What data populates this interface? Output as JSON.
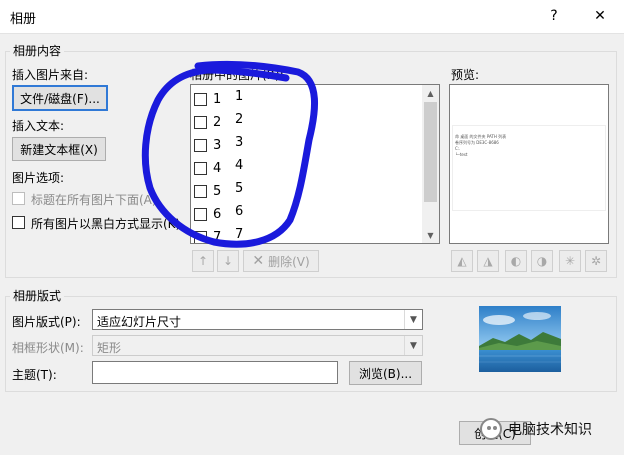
{
  "window": {
    "title": "相册",
    "help_glyph": "?",
    "close_glyph": "✕"
  },
  "album_content": {
    "legend": "相册内容",
    "insert_from_label": "插入图片来自:",
    "file_button": "文件/磁盘(F)...",
    "insert_text_label": "插入文本:",
    "new_textbox_button": "新建文本框(X)",
    "picture_options_label": "图片选项:",
    "caption_option": "标题在所有图片下面(A)",
    "bw_option": "所有图片以黑白方式显示(K)"
  },
  "picture_list": {
    "label": "相册中的图片(R):",
    "items": [
      {
        "index": "1",
        "name": "1"
      },
      {
        "index": "2",
        "name": "2"
      },
      {
        "index": "3",
        "name": "3"
      },
      {
        "index": "4",
        "name": "4"
      },
      {
        "index": "5",
        "name": "5"
      },
      {
        "index": "6",
        "name": "6"
      },
      {
        "index": "7",
        "name": "7"
      }
    ],
    "move_up_icon": "arrow-up-icon",
    "move_down_icon": "arrow-down-icon",
    "delete_button": "删除(V)"
  },
  "preview": {
    "label": "预览:",
    "slide_lines": [
      "命 桌面 的文件夹 PATH 列表",
      "卷序列号为 DE3C-8686",
      "C:.",
      "└─test"
    ]
  },
  "album_layout": {
    "legend": "相册版式",
    "picture_layout_label": "图片版式(P):",
    "picture_layout_value": "适应幻灯片尺寸",
    "frame_shape_label": "相框形状(M):",
    "frame_shape_value": "矩形",
    "theme_label": "主题(T):",
    "theme_value": "",
    "browse_button": "浏览(B)..."
  },
  "footer": {
    "create_button": "创建(C)"
  },
  "watermark": {
    "text": "电脑技术知识"
  },
  "colors": {
    "annotation_blue": "#1a1adc",
    "focus_blue": "#3079d6"
  }
}
